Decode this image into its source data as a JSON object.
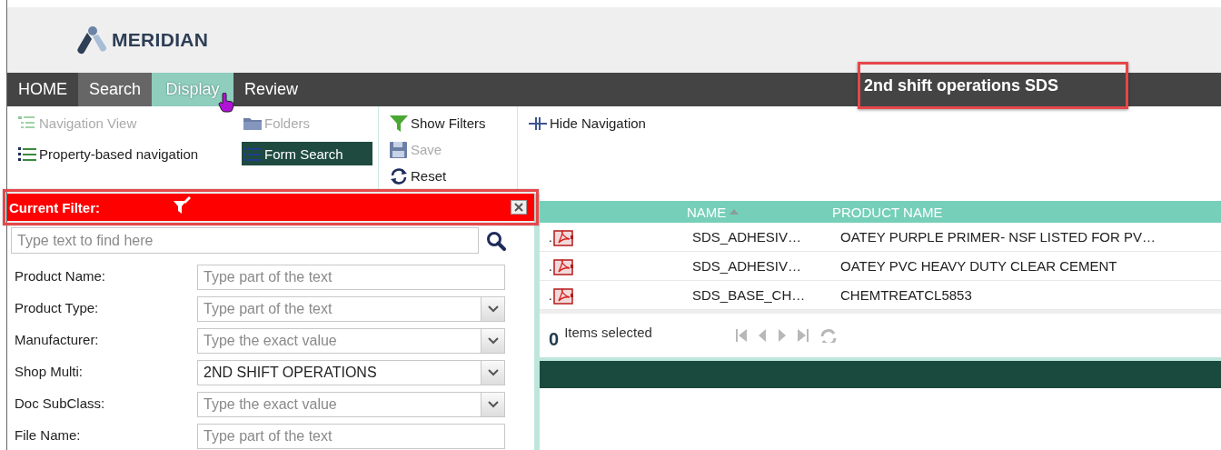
{
  "header": {
    "logo_text": "MERIDIAN"
  },
  "nav": {
    "tabs": [
      {
        "label": "HOME",
        "selected": false,
        "hovered": false
      },
      {
        "label": "Search",
        "selected": false,
        "hovered": true
      },
      {
        "label": "Display",
        "selected": true,
        "hovered": false
      },
      {
        "label": "Review",
        "selected": false,
        "hovered": false
      }
    ],
    "title": "2nd shift operations SDS",
    "title_highlighted": true
  },
  "toolbar": {
    "groups": [
      {
        "items": [
          {
            "kind": "navview",
            "label": "Navigation View",
            "disabled": true,
            "selected": false
          },
          {
            "kind": "folders",
            "label": "Folders",
            "disabled": true,
            "selected": false
          },
          {
            "kind": "list",
            "label": "Property-based navigation",
            "disabled": false,
            "selected": false
          },
          {
            "kind": "form",
            "label": "Form Search",
            "disabled": false,
            "selected": true
          }
        ]
      },
      {
        "items": [
          {
            "kind": "filter",
            "label": "Show Filters",
            "disabled": false,
            "selected": false
          },
          {
            "kind": "save",
            "label": "Save",
            "disabled": true,
            "selected": false
          },
          {
            "kind": "reset",
            "label": "Reset",
            "disabled": false,
            "selected": false
          }
        ]
      },
      {
        "items": [
          {
            "kind": "hidenav",
            "label": "Hide Navigation",
            "disabled": false,
            "selected": false
          }
        ]
      }
    ]
  },
  "filter_panel": {
    "title": "Current Filter:",
    "highlighted": true,
    "search": {
      "placeholder": "Type text to find here"
    },
    "fields": [
      {
        "label": "Product Name:",
        "kind": "text",
        "placeholder": "Type part of the text"
      },
      {
        "label": "Product Type:",
        "kind": "dropdown",
        "placeholder": "Type part of the text"
      },
      {
        "label": "Manufacturer:",
        "kind": "dropdown",
        "placeholder": "Type the exact value"
      },
      {
        "label": "Shop Multi:",
        "kind": "dropdown",
        "value": "2ND SHIFT OPERATIONS"
      },
      {
        "label": "Doc SubClass:",
        "kind": "dropdown",
        "placeholder": "Type the exact value"
      },
      {
        "label": "File Name:",
        "kind": "text",
        "placeholder": "Type part of the text"
      }
    ]
  },
  "grid": {
    "columns": [
      {
        "label": "NAME",
        "sorted_ascending": true
      },
      {
        "label": "PRODUCT NAME",
        "sorted_ascending": false
      }
    ],
    "rows": [
      {
        "column_1": ".",
        "name": "SDS_ADHESIV…",
        "product_name": "OATEY PURPLE PRIMER- NSF LISTED FOR PV…"
      },
      {
        "column_1": ".",
        "name": "SDS_ADHESIV…",
        "product_name": "OATEY PVC HEAVY DUTY CLEAR CEMENT"
      },
      {
        "column_1": ".",
        "name": "SDS_BASE_CH…",
        "product_name": "CHEMTREATCL5853"
      }
    ],
    "selected_count": "0",
    "selected_label": "Items selected"
  }
}
